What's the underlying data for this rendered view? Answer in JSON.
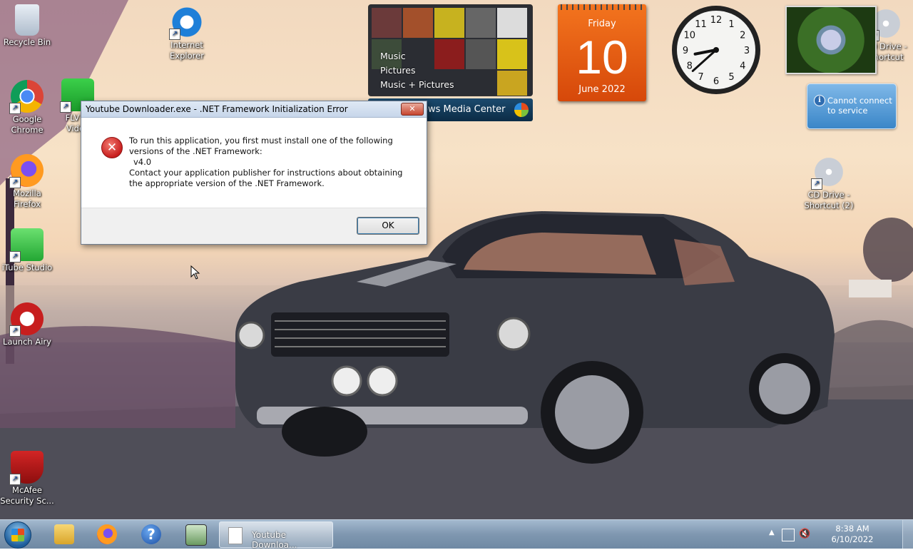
{
  "desktop_icons": [
    {
      "label": "Recycle Bin"
    },
    {
      "label": "Internet Explorer"
    },
    {
      "label": "Google Chrome"
    },
    {
      "label": "FLV to Video"
    },
    {
      "label": "Mozilla Firefox"
    },
    {
      "label": "iTube Studio"
    },
    {
      "label": "Launch Airy"
    },
    {
      "label": "McAfee Security Sc..."
    },
    {
      "label": "CD Drive - Shortcut"
    },
    {
      "label": "CD Drive - Shortcut (2)"
    }
  ],
  "media_center": {
    "menu": [
      "Music",
      "Pictures",
      "Music + Pictures"
    ],
    "bar_label": "ows Media Center"
  },
  "calendar": {
    "weekday": "Friday",
    "day": "10",
    "month_year": "June 2022"
  },
  "clock": {
    "hour": 8,
    "minute": 38
  },
  "weather": {
    "message": "Cannot connect to service",
    "icon": "info-icon"
  },
  "dialog": {
    "title": "Youtube Downloader.exe - .NET Framework Initialization Error",
    "close_label": "✕",
    "icon": "error-icon",
    "line1": "To run this application, you first must install one of the following versions of the .NET Framework:",
    "version": "v4.0",
    "line2": "Contact your application publisher for instructions about obtaining the appropriate version of the .NET Framework.",
    "ok_label": "OK"
  },
  "taskbar": {
    "pinned": [
      "windows-explorer",
      "firefox",
      "help",
      "network-tool"
    ],
    "active_window": "Youtube Downloa...",
    "time": "8:38 AM",
    "date": "6/10/2022"
  },
  "colors": {
    "calendar_orange": "#e85d13",
    "dialog_title_bg": "#c7d6ea",
    "error_red": "#c81e1e"
  }
}
